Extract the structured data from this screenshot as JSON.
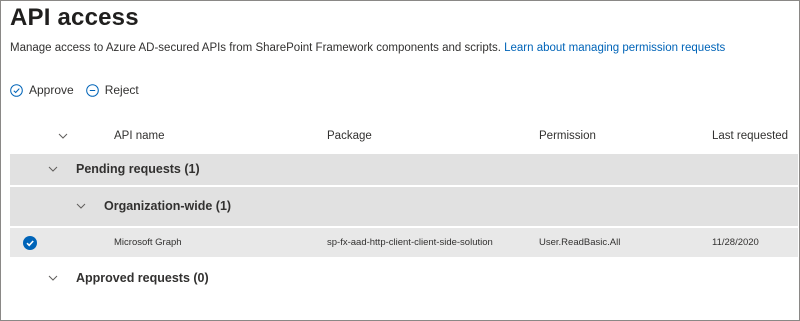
{
  "page": {
    "title": "API access",
    "description": "Manage access to Azure AD-secured APIs from SharePoint Framework components and scripts.",
    "learn_link": "Learn about managing permission requests"
  },
  "toolbar": {
    "approve_label": "Approve",
    "reject_label": "Reject"
  },
  "columns": {
    "api_name": "API name",
    "package": "Package",
    "permission": "Permission",
    "last_requested": "Last requested"
  },
  "groups": {
    "pending": "Pending requests (1)",
    "org_wide": "Organization-wide (1)",
    "approved": "Approved requests (0)"
  },
  "rows": [
    {
      "api_name": "Microsoft Graph",
      "package": "sp-fx-aad-http-client-client-side-solution",
      "permission": "User.ReadBasic.All",
      "last_requested": "11/28/2020",
      "selected": true
    }
  ],
  "colors": {
    "accent": "#0064b8",
    "group_bg": "#e1e1e1",
    "row_bg": "#e8e8e8",
    "text": "#323130"
  }
}
